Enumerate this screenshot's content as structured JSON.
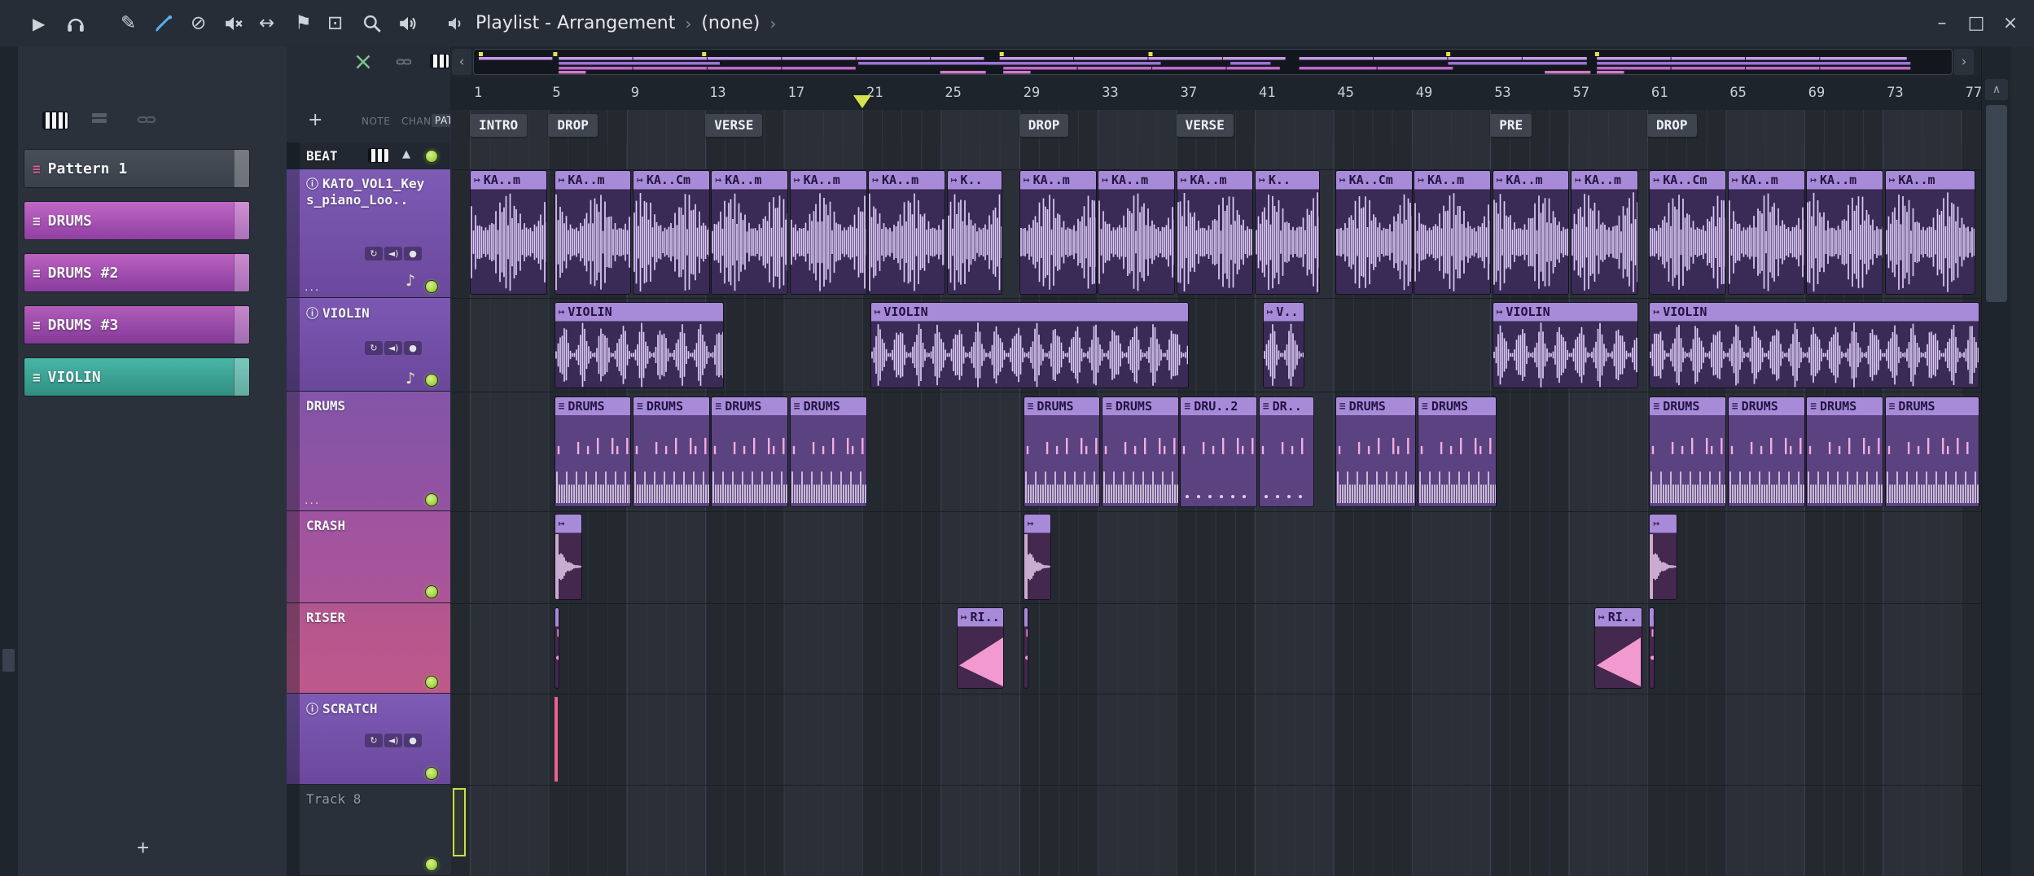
{
  "window": {
    "title": "Playlist - Arrangement",
    "subtitle": "(none)",
    "crumb_sep": "›",
    "controls": {
      "minimize": "–",
      "maximize": "□",
      "close": "×"
    }
  },
  "toolbar": {
    "glyphs": {
      "play": "▶",
      "pencil": "✎",
      "mute_circle": "⊘",
      "stretch": "↔",
      "flag": "⚑",
      "zoom_box": "⊡"
    }
  },
  "patterns": {
    "add_label": "+",
    "items": [
      {
        "label": "Pattern 1",
        "color1": "#474e58",
        "color2": "#3a414c",
        "icon_color": "#e0608e"
      },
      {
        "label": "DRUMS",
        "color1": "#c168c6",
        "color2": "#8f3fa2",
        "icon_color": "#f4e8f6"
      },
      {
        "label": "DRUMS #2",
        "color1": "#bb62c1",
        "color2": "#8a3c9e",
        "icon_color": "#f4e8f6"
      },
      {
        "label": "DRUMS #3",
        "color1": "#b25cba",
        "color2": "#843a98",
        "icon_color": "#f4e8f6"
      },
      {
        "label": "VIOLIN",
        "color1": "#49b6a6",
        "color2": "#2f8e82",
        "icon_color": "#eaf6f2"
      }
    ]
  },
  "track_panel": {
    "add_label": "+",
    "columns": [
      "NOTE",
      "CHAN",
      "PAT"
    ],
    "channel_buttons": [
      "↻",
      "◄)",
      "●"
    ],
    "clef_glyph": "♪",
    "info_glyph": "ⓘ",
    "collapse_glyph": "▲",
    "grip_glyph": "...",
    "led_color": "#a9d84b",
    "tracks": [
      {
        "id": "beat",
        "name": "BEAT"
      },
      {
        "id": "kato",
        "name": "KATO_VOL1_Keys_piano_Loo.."
      },
      {
        "id": "violin",
        "name": "VIOLIN"
      },
      {
        "id": "drums",
        "name": "DRUMS"
      },
      {
        "id": "crash",
        "name": "CRASH"
      },
      {
        "id": "riser",
        "name": "RISER"
      },
      {
        "id": "scratch",
        "name": "SCRATCH"
      },
      {
        "id": "track8",
        "name": "Track 8"
      }
    ]
  },
  "clip_icons": {
    "audio": "↦",
    "pattern": "≡"
  },
  "playlist": {
    "scroll": {
      "left": "‹",
      "right": "›",
      "up": "∧"
    },
    "bar_numbers": [
      1,
      5,
      9,
      13,
      17,
      21,
      25,
      29,
      33,
      37,
      41,
      45,
      49,
      53,
      57,
      61,
      65,
      69,
      73,
      77
    ],
    "markers": [
      {
        "label": "INTRO",
        "bar": 1
      },
      {
        "label": "DROP",
        "bar": 5
      },
      {
        "label": "VERSE",
        "bar": 13
      },
      {
        "label": "DROP",
        "bar": 29
      },
      {
        "label": "VERSE",
        "bar": 37
      },
      {
        "label": "PRE",
        "bar": 53
      },
      {
        "label": "DROP",
        "bar": 61
      }
    ],
    "playhead_bar": 21,
    "tracks": {
      "beat": [
        {
          "bar": 1,
          "len": 4,
          "label": "KA..m"
        },
        {
          "bar": 5.3,
          "len": 4,
          "label": "KA..m"
        },
        {
          "bar": 9.3,
          "len": 4,
          "label": "KA..Cm"
        },
        {
          "bar": 13.3,
          "len": 4,
          "label": "KA..m"
        },
        {
          "bar": 17.3,
          "len": 4,
          "label": "KA..m"
        },
        {
          "bar": 21.3,
          "len": 4,
          "label": "KA..m"
        },
        {
          "bar": 25.3,
          "len": 2.9,
          "label": "K.."
        },
        {
          "bar": 29,
          "len": 4,
          "label": "KA..m"
        },
        {
          "bar": 33,
          "len": 4,
          "label": "KA..m"
        },
        {
          "bar": 37,
          "len": 4,
          "label": "KA..m"
        },
        {
          "bar": 41,
          "len": 3.4,
          "label": "K.."
        },
        {
          "bar": 45.1,
          "len": 4,
          "label": "KA..Cm"
        },
        {
          "bar": 49.1,
          "len": 4,
          "label": "KA..m"
        },
        {
          "bar": 53.1,
          "len": 4,
          "label": "KA..m"
        },
        {
          "bar": 57.1,
          "len": 3.5,
          "label": "KA..m"
        },
        {
          "bar": 61.1,
          "len": 4,
          "label": "KA..Cm"
        },
        {
          "bar": 65.1,
          "len": 4,
          "label": "KA..m"
        },
        {
          "bar": 69.1,
          "len": 4,
          "label": "KA..m"
        },
        {
          "bar": 73.1,
          "len": 4.7,
          "label": "KA..m"
        }
      ],
      "violin": [
        {
          "bar": 5.3,
          "len": 8.7,
          "label": "VIOLIN"
        },
        {
          "bar": 21.4,
          "len": 16.3,
          "label": "VIOLIN"
        },
        {
          "bar": 41.4,
          "len": 2.2,
          "label": "V.."
        },
        {
          "bar": 53.1,
          "len": 7.5,
          "label": "VIOLIN"
        },
        {
          "bar": 61.1,
          "len": 16.9,
          "label": "VIOLIN"
        }
      ],
      "drums": [
        {
          "bar": 5.3,
          "len": 4,
          "label": "DRUMS"
        },
        {
          "bar": 9.3,
          "len": 4,
          "label": "DRUMS"
        },
        {
          "bar": 13.3,
          "len": 4,
          "label": "DRUMS"
        },
        {
          "bar": 17.3,
          "len": 4,
          "label": "DRUMS"
        },
        {
          "bar": 29.2,
          "len": 4,
          "label": "DRUMS"
        },
        {
          "bar": 33.2,
          "len": 4,
          "label": "DRUMS"
        },
        {
          "bar": 37.2,
          "len": 4,
          "label": "DRU..2",
          "variant": "sparse"
        },
        {
          "bar": 41.2,
          "len": 2.9,
          "label": "DR..",
          "variant": "sparse"
        },
        {
          "bar": 45.1,
          "len": 4.2,
          "label": "DRUMS"
        },
        {
          "bar": 49.3,
          "len": 4.1,
          "label": "DRUMS"
        },
        {
          "bar": 61.1,
          "len": 4,
          "label": "DRUMS"
        },
        {
          "bar": 65.1,
          "len": 4,
          "label": "DRUMS"
        },
        {
          "bar": 69.1,
          "len": 4,
          "label": "DRUMS"
        },
        {
          "bar": 73.1,
          "len": 4.9,
          "label": "DRUMS"
        }
      ],
      "crash": [
        {
          "bar": 5.3,
          "len": 1.5
        },
        {
          "bar": 29.2,
          "len": 1.5
        },
        {
          "bar": 61.1,
          "len": 1.5
        }
      ],
      "riser": [
        {
          "bar": 5.3,
          "len": 0.35,
          "kind": "sliver"
        },
        {
          "bar": 25.8,
          "len": 2.5,
          "label": "RI..",
          "kind": "riser"
        },
        {
          "bar": 29.2,
          "len": 0.35,
          "kind": "sliver"
        },
        {
          "bar": 58.3,
          "len": 2.5,
          "label": "RI..",
          "kind": "riser"
        },
        {
          "bar": 61.1,
          "len": 0.35,
          "kind": "sliver"
        }
      ],
      "scratch": [
        {
          "bar": 5.3,
          "len": 0.15,
          "kind": "line"
        }
      ]
    }
  }
}
